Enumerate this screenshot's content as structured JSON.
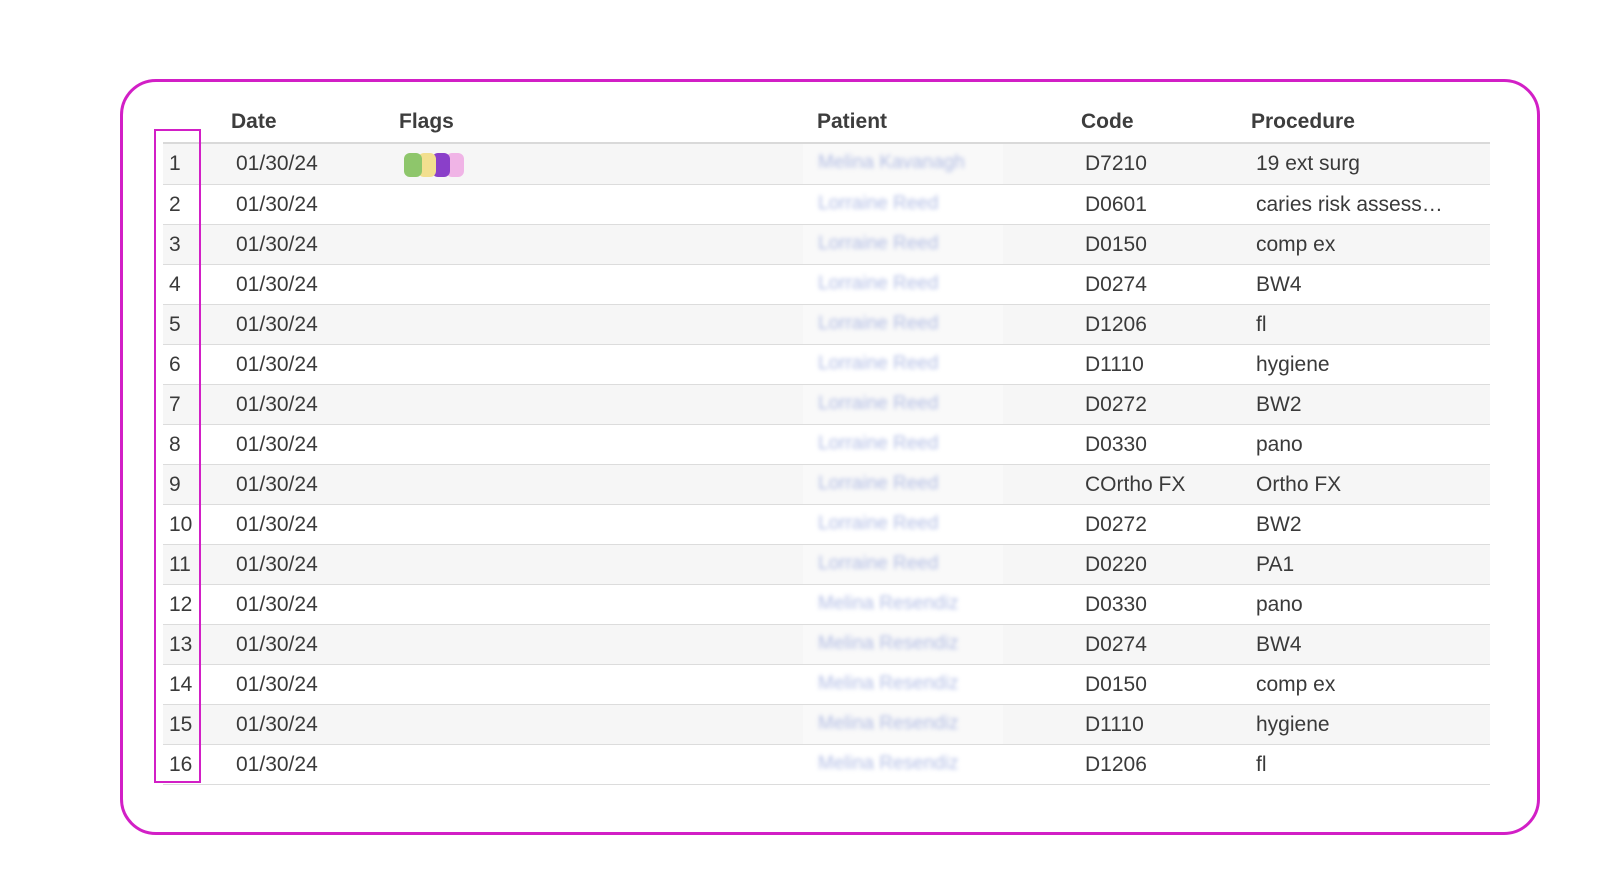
{
  "table": {
    "headers": {
      "num": "",
      "date": "Date",
      "flags": "Flags",
      "patient": "Patient",
      "code": "Code",
      "procedure": "Procedure"
    },
    "rows": [
      {
        "num": "1",
        "date": "01/30/24",
        "patient": "Melina Kavanagh",
        "code": "D7210",
        "procedure": "19 ext surg",
        "flags": [
          "#8ec66b",
          "#f2df8f",
          "#8a3fc9",
          "#f0b4e6"
        ]
      },
      {
        "num": "2",
        "date": "01/30/24",
        "patient": "Lorraine Reed",
        "code": "D0601",
        "procedure": "caries risk assess…",
        "flags": []
      },
      {
        "num": "3",
        "date": "01/30/24",
        "patient": "Lorraine Reed",
        "code": "D0150",
        "procedure": "comp ex",
        "flags": []
      },
      {
        "num": "4",
        "date": "01/30/24",
        "patient": "Lorraine Reed",
        "code": "D0274",
        "procedure": "BW4",
        "flags": []
      },
      {
        "num": "5",
        "date": "01/30/24",
        "patient": "Lorraine Reed",
        "code": "D1206",
        "procedure": "fl",
        "flags": []
      },
      {
        "num": "6",
        "date": "01/30/24",
        "patient": "Lorraine Reed",
        "code": "D1110",
        "procedure": "hygiene",
        "flags": []
      },
      {
        "num": "7",
        "date": "01/30/24",
        "patient": "Lorraine Reed",
        "code": "D0272",
        "procedure": "BW2",
        "flags": []
      },
      {
        "num": "8",
        "date": "01/30/24",
        "patient": "Lorraine Reed",
        "code": "D0330",
        "procedure": "pano",
        "flags": []
      },
      {
        "num": "9",
        "date": "01/30/24",
        "patient": "Lorraine Reed",
        "code": "COrtho FX",
        "procedure": "Ortho FX",
        "flags": []
      },
      {
        "num": "10",
        "date": "01/30/24",
        "patient": "Lorraine Reed",
        "code": "D0272",
        "procedure": "BW2",
        "flags": []
      },
      {
        "num": "11",
        "date": "01/30/24",
        "patient": "Lorraine Reed",
        "code": "D0220",
        "procedure": "PA1",
        "flags": []
      },
      {
        "num": "12",
        "date": "01/30/24",
        "patient": "Melina Resendiz",
        "code": "D0330",
        "procedure": "pano",
        "flags": []
      },
      {
        "num": "13",
        "date": "01/30/24",
        "patient": "Melina Resendiz",
        "code": "D0274",
        "procedure": "BW4",
        "flags": []
      },
      {
        "num": "14",
        "date": "01/30/24",
        "patient": "Melina Resendiz",
        "code": "D0150",
        "procedure": "comp ex",
        "flags": []
      },
      {
        "num": "15",
        "date": "01/30/24",
        "patient": "Melina Resendiz",
        "code": "D1110",
        "procedure": "hygiene",
        "flags": []
      },
      {
        "num": "16",
        "date": "01/30/24",
        "patient": "Melina Resendiz",
        "code": "D1206",
        "procedure": "fl",
        "flags": []
      }
    ]
  },
  "colors": {
    "highlight_border": "#d21fc6",
    "row_stripe": "#f6f6f6",
    "patient_text": "#9aa9dd"
  }
}
